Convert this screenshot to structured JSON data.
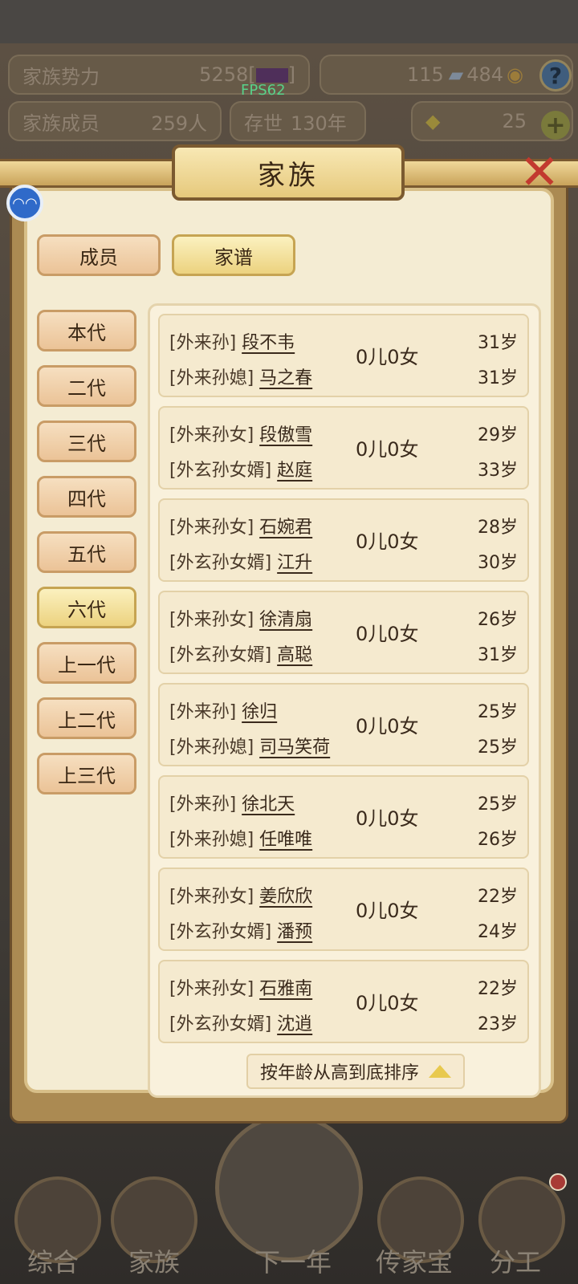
{
  "top_bar": {
    "power_label": "家族势力",
    "power_value": "5258",
    "power_bracket_open": "[",
    "power_bracket_close": "]",
    "silver": "115",
    "copper": "484",
    "help": "?",
    "members_label": "家族成员",
    "members_value": "259人",
    "exist_label": "存世",
    "exist_value": "130年",
    "gold": "25",
    "plus": "+"
  },
  "fps": "FPS62",
  "modal": {
    "title": "家族",
    "close": "✕",
    "tabs": [
      {
        "label": "成员",
        "active": false
      },
      {
        "label": "家谱",
        "active": true
      }
    ],
    "generations": [
      {
        "label": "本代",
        "active": false
      },
      {
        "label": "二代",
        "active": false
      },
      {
        "label": "三代",
        "active": false
      },
      {
        "label": "四代",
        "active": false
      },
      {
        "label": "五代",
        "active": false
      },
      {
        "label": "六代",
        "active": true
      },
      {
        "label": "上一代",
        "active": false
      },
      {
        "label": "上二代",
        "active": false
      },
      {
        "label": "上三代",
        "active": false
      }
    ],
    "couples": [
      {
        "a_tag": "[外来孙]",
        "a_name": "段不韦",
        "a_age": "31岁",
        "b_tag": "[外来孙媳]",
        "b_name": "马之春",
        "b_age": "31岁",
        "children": "0儿0女"
      },
      {
        "a_tag": "[外来孙女]",
        "a_name": "段傲雪",
        "a_age": "29岁",
        "b_tag": "[外玄孙女婿]",
        "b_name": "赵庭",
        "b_age": "33岁",
        "children": "0儿0女"
      },
      {
        "a_tag": "[外来孙女]",
        "a_name": "石婉君",
        "a_age": "28岁",
        "b_tag": "[外玄孙女婿]",
        "b_name": "江升",
        "b_age": "30岁",
        "children": "0儿0女"
      },
      {
        "a_tag": "[外来孙女]",
        "a_name": "徐清扇",
        "a_age": "26岁",
        "b_tag": "[外玄孙女婿]",
        "b_name": "高聪",
        "b_age": "31岁",
        "children": "0儿0女"
      },
      {
        "a_tag": "[外来孙]",
        "a_name": "徐归",
        "a_age": "25岁",
        "b_tag": "[外来孙媳]",
        "b_name": "司马笑荷",
        "b_age": "25岁",
        "children": "0儿0女"
      },
      {
        "a_tag": "[外来孙]",
        "a_name": "徐北天",
        "a_age": "25岁",
        "b_tag": "[外来孙媳]",
        "b_name": "任唯唯",
        "b_age": "26岁",
        "children": "0儿0女"
      },
      {
        "a_tag": "[外来孙女]",
        "a_name": "姜欣欣",
        "a_age": "22岁",
        "b_tag": "[外玄孙女婿]",
        "b_name": "潘预",
        "b_age": "24岁",
        "children": "0儿0女"
      },
      {
        "a_tag": "[外来孙女]",
        "a_name": "石雅南",
        "a_age": "22岁",
        "b_tag": "[外玄孙女婿]",
        "b_name": "沈逍",
        "b_age": "23岁",
        "children": "0儿0女"
      }
    ],
    "sort_label": "按年龄从高到底排序"
  },
  "bottom_nav": [
    {
      "label": "综合",
      "icon": "scroll-icon"
    },
    {
      "label": "家族",
      "icon": "house-icon"
    },
    {
      "label": "下一年",
      "icon": "mountain-icon"
    },
    {
      "label": "传家宝",
      "icon": "treasure-icon"
    },
    {
      "label": "分工",
      "icon": "worker-icon"
    }
  ],
  "colors": {
    "accent_gold": "#e8c94e",
    "close_red": "#c23a2f",
    "fps_green": "#58d28a",
    "panel_bg": "#f4ecd3"
  }
}
